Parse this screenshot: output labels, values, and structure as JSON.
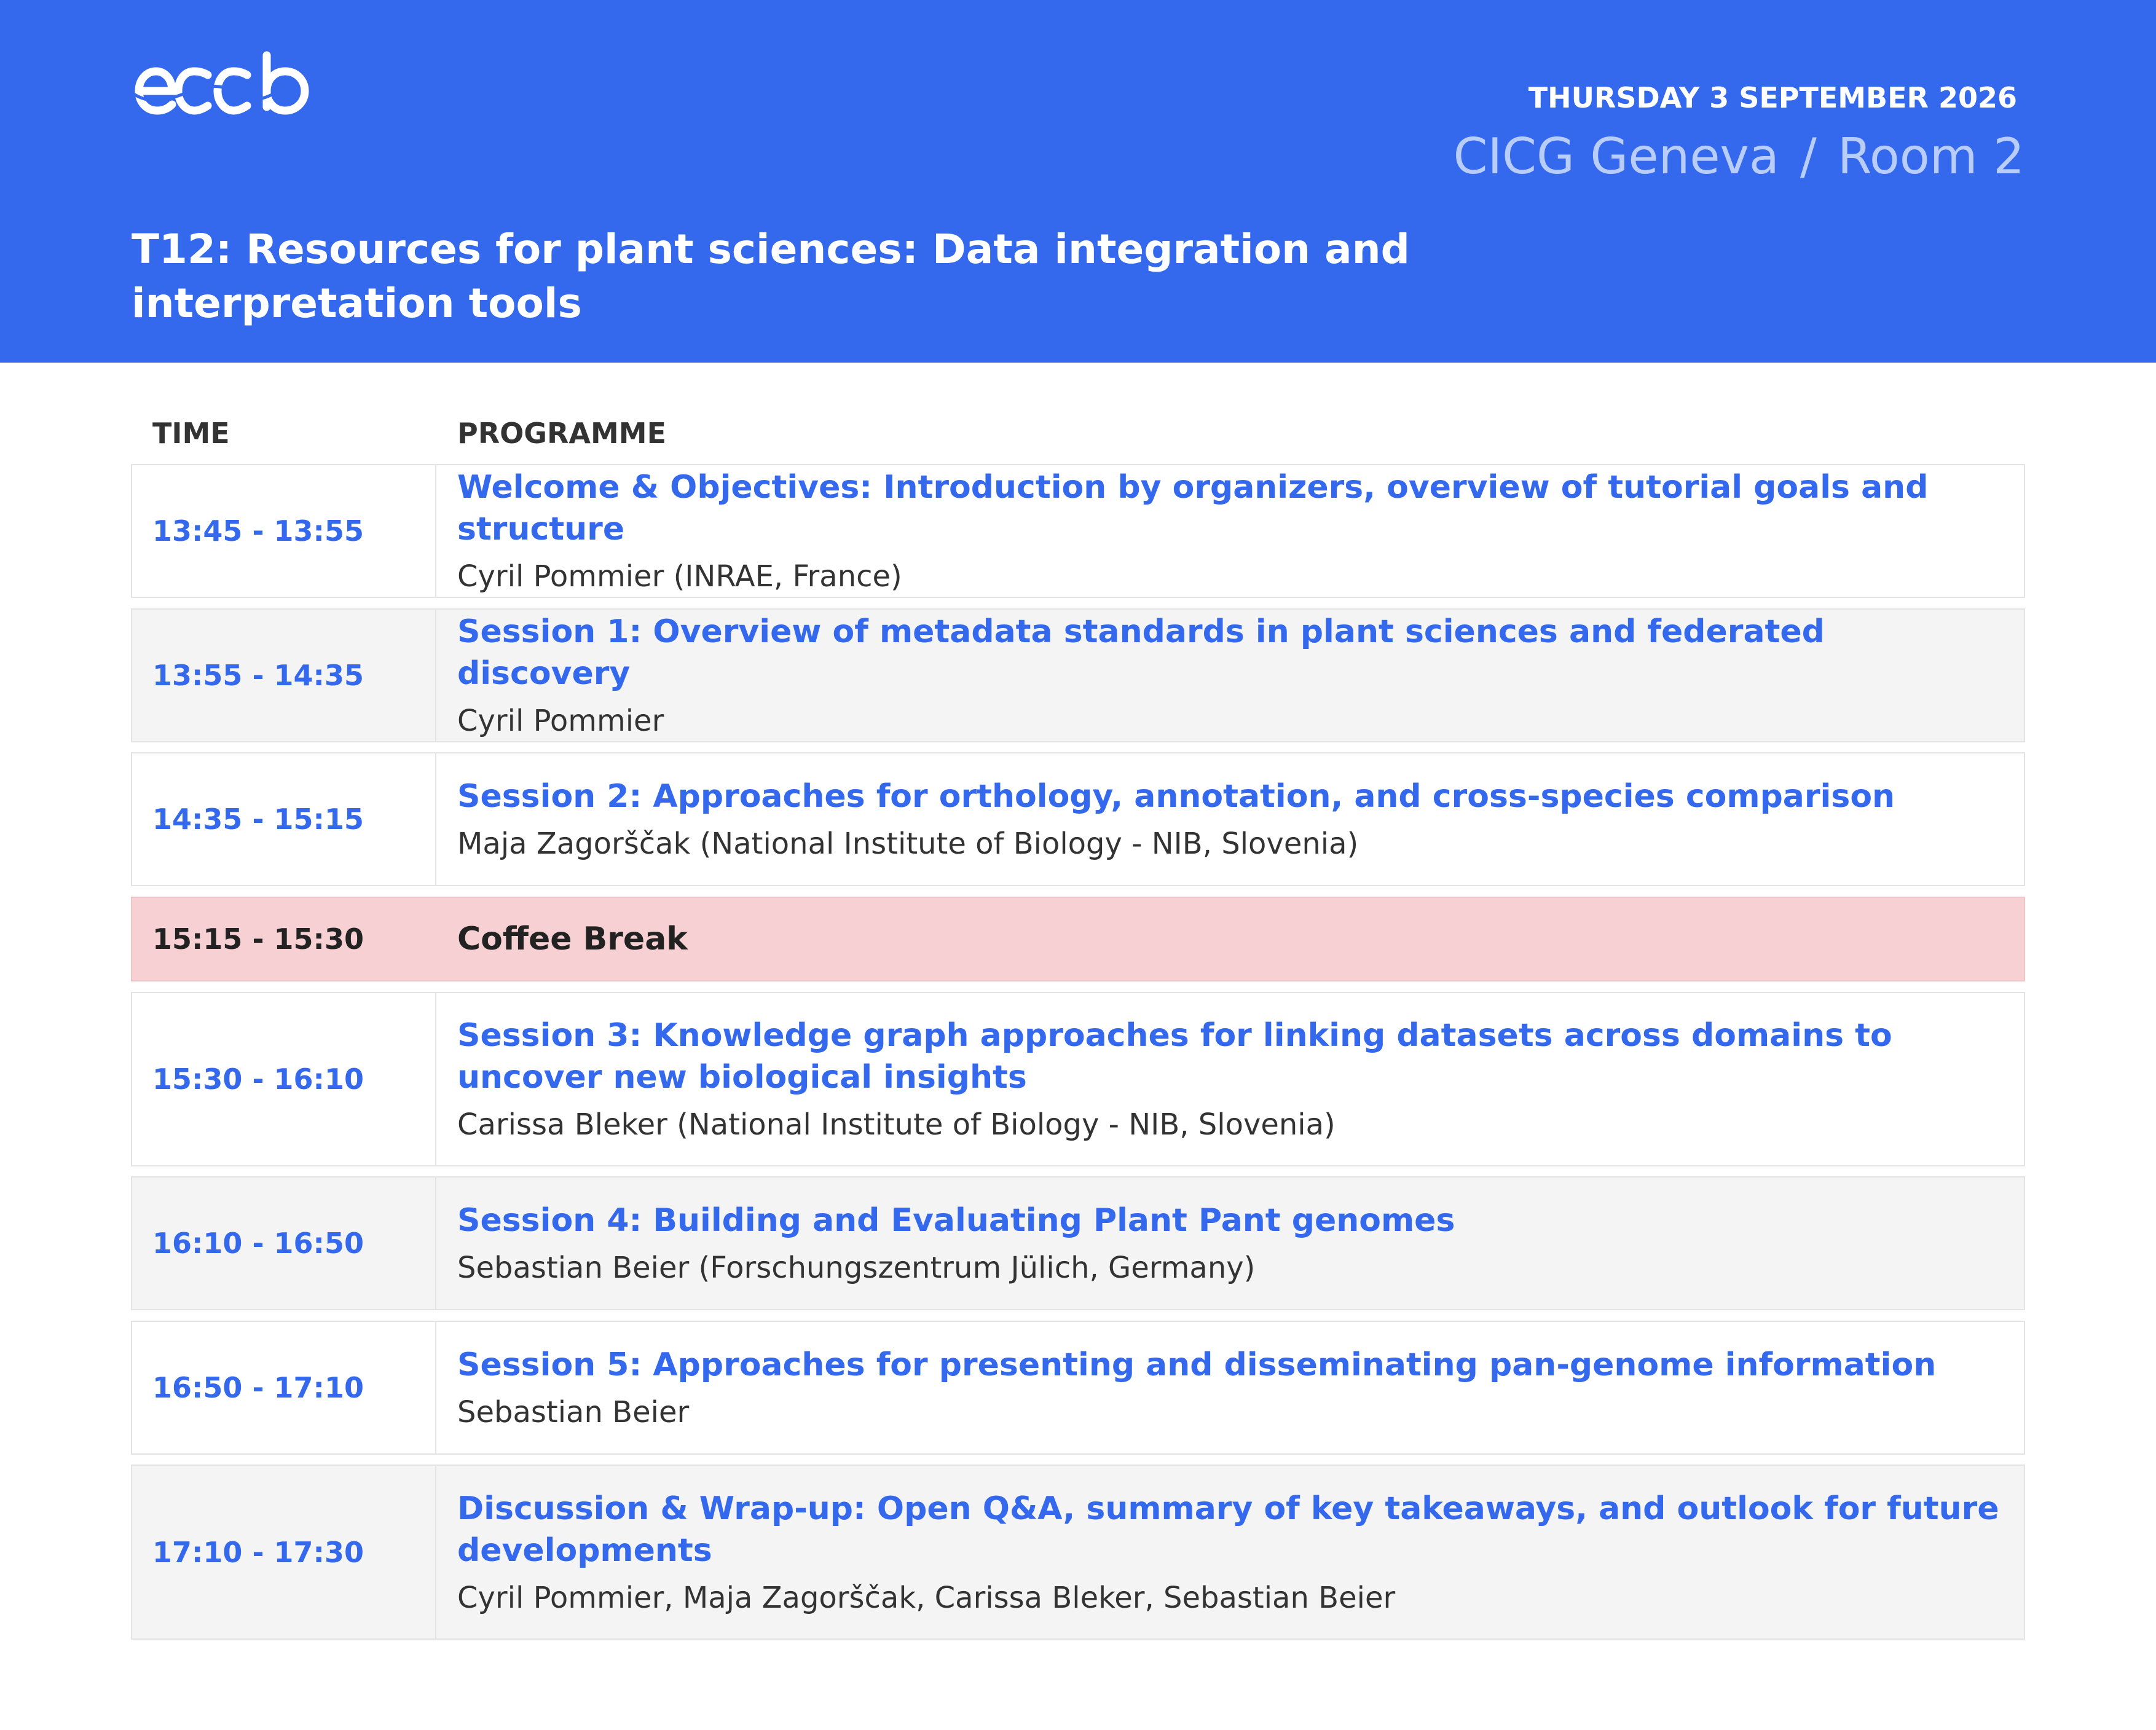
{
  "header": {
    "logo_text": "eccb",
    "date": "THURSDAY 3 SEPTEMBER 2026",
    "venue": "CICG Geneva",
    "venue_separator": "/",
    "room": "Room 2",
    "title": "T12: Resources for plant sciences: Data integration and interpretation tools",
    "colors": {
      "header_bg": "#3469ee",
      "accent": "#3469ee",
      "break_bg": "#f6d0d2"
    }
  },
  "table": {
    "col_time": "TIME",
    "col_programme": "PROGRAMME",
    "rows": [
      {
        "time": "13:45 - 13:55",
        "title": "Welcome & Objectives: Introduction by organizers, overview of tutorial goals and structure",
        "speaker": "Cyril Pommier (INRAE, France)"
      },
      {
        "time": "13:55 - 14:35",
        "title": "Session 1: Overview of metadata standards in plant sciences and federated discovery",
        "speaker": "Cyril Pommier"
      },
      {
        "time": "14:35 - 15:15",
        "title": "Session 2: Approaches for orthology, annotation, and cross-species comparison",
        "speaker": "Maja Zagorščak (National Institute of Biology - NIB, Slovenia)"
      },
      {
        "time": "15:15 - 15:30",
        "title": "Coffee Break"
      },
      {
        "time": "15:30 - 16:10",
        "title": "Session 3: Knowledge graph approaches for linking datasets across domains to uncover new biological insights",
        "speaker": "Carissa Bleker (National Institute of Biology - NIB, Slovenia)"
      },
      {
        "time": "16:10 - 16:50",
        "title": "Session 4: Building and Evaluating Plant Pant genomes",
        "speaker": "Sebastian Beier (Forschungszentrum Jülich, Germany)"
      },
      {
        "time": "16:50 - 17:10",
        "title": "Session 5: Approaches for presenting and disseminating pan-genome information",
        "speaker": "Sebastian Beier"
      },
      {
        "time": "17:10 - 17:30",
        "title": "Discussion & Wrap-up: Open Q&A, summary of key takeaways, and outlook for future developments",
        "speaker": "Cyril Pommier, Maja Zagorščak, Carissa Bleker, Sebastian Beier"
      }
    ]
  }
}
